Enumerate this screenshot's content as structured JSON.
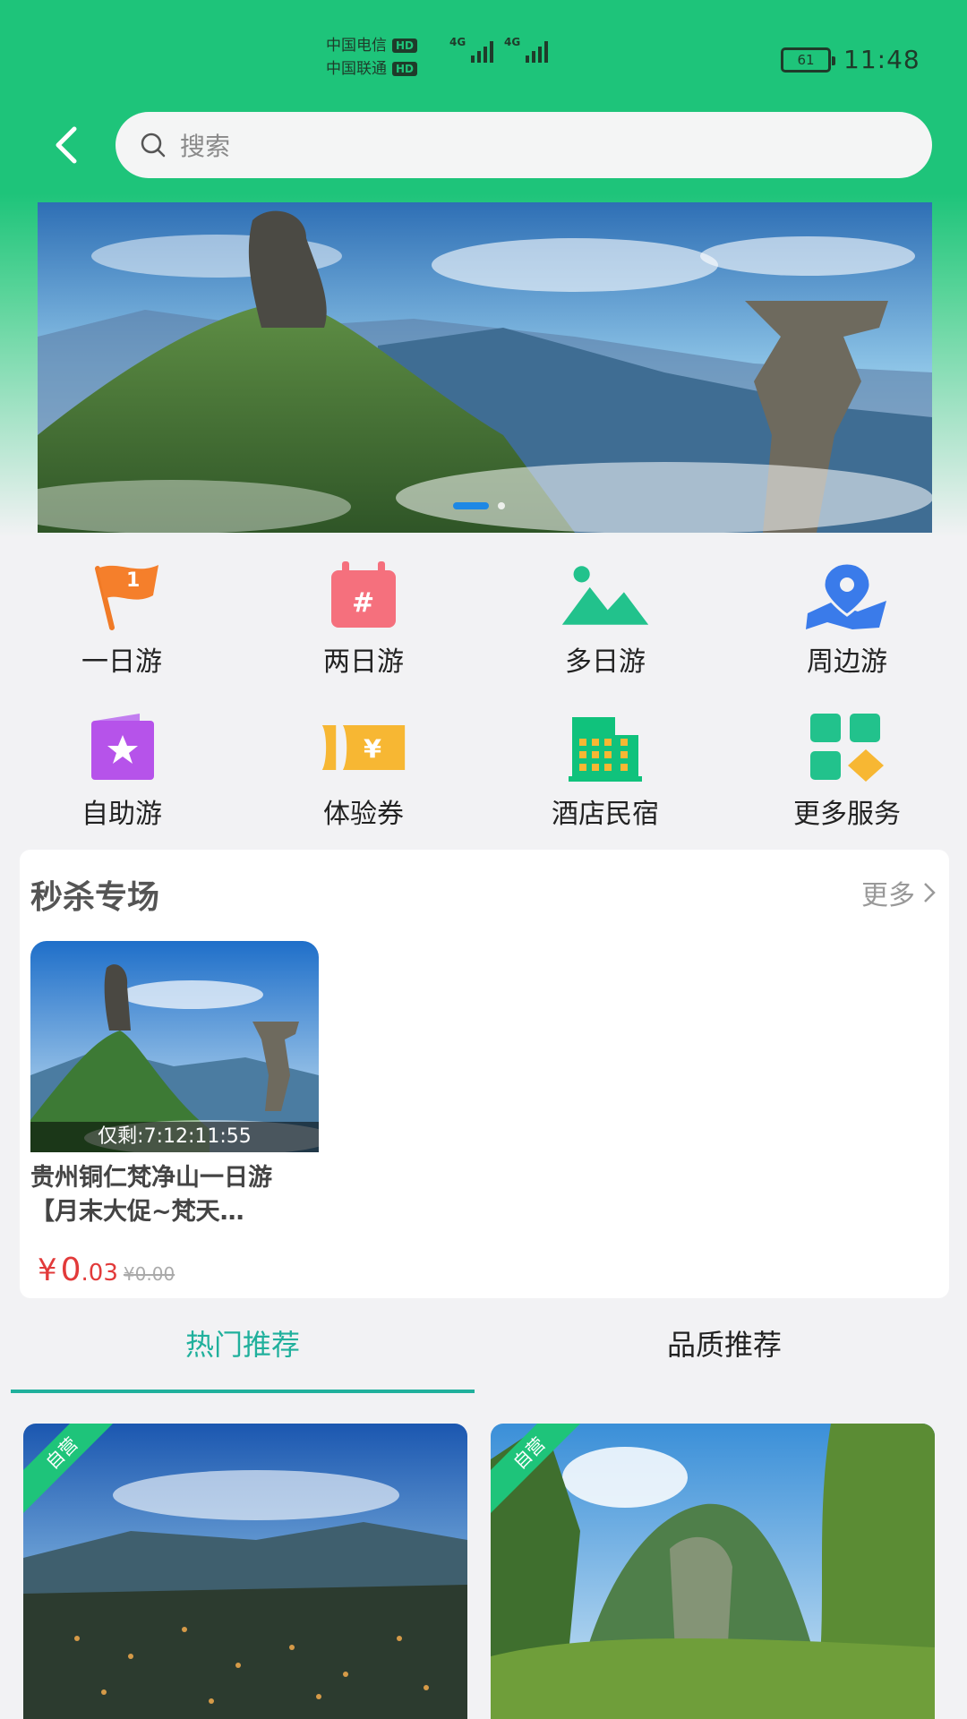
{
  "status_bar": {
    "carrier_1": "中国电信",
    "carrier_2": "中国联通",
    "hd": "HD",
    "network": "4G",
    "battery": "61",
    "time": "11:48"
  },
  "header": {
    "search_placeholder": "搜索"
  },
  "banner": {
    "slide_count": 2,
    "active_slide": 1
  },
  "categories": [
    {
      "label": "一日游",
      "icon": "flag-icon"
    },
    {
      "label": "两日游",
      "icon": "calendar-icon"
    },
    {
      "label": "多日游",
      "icon": "mountain-icon"
    },
    {
      "label": "周边游",
      "icon": "map-pin-icon"
    },
    {
      "label": "自助游",
      "icon": "star-card-icon"
    },
    {
      "label": "体验券",
      "icon": "coupon-icon"
    },
    {
      "label": "酒店民宿",
      "icon": "hotel-icon"
    },
    {
      "label": "更多服务",
      "icon": "grid-icon"
    }
  ],
  "flash_sale": {
    "title": "秒杀专场",
    "more": "更多",
    "item": {
      "countdown": "仅剩:7:12:11:55",
      "name": "贵州铜仁梵净山一日游【月末大促~梵天…",
      "currency": "¥",
      "price_int": "0",
      "price_dec": ".03",
      "price_old": "¥0.00"
    }
  },
  "tabs": {
    "hot": "热门推荐",
    "quality": "品质推荐"
  },
  "products": [
    {
      "badge": "自营"
    },
    {
      "badge": "自营"
    }
  ],
  "colors": {
    "brand_green": "#1ec47a",
    "tab_active": "#20b09c",
    "price_red": "#e23a3a"
  }
}
